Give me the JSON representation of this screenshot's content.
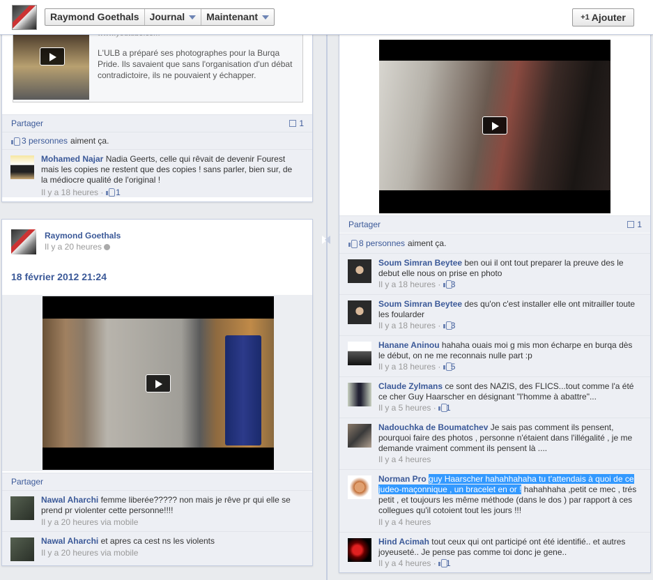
{
  "header": {
    "profile_name": "Raymond Goethals",
    "journal_label": "Journal",
    "now_label": "Maintenant",
    "add_label": "Ajouter",
    "add_prefix": "+1"
  },
  "left_top": {
    "attachment_url": "www.youtube.com",
    "attachment_text": "L'ULB a préparé ses photographes pour la Burqa Pride. Ils savaient que sans l'organisation d'un débat contradictoire, ils ne pouvaient y échapper.",
    "share_label": "Partager",
    "comment_count": "1",
    "likes_count": "3 personnes",
    "likes_suffix": "aiment ça.",
    "comments": [
      {
        "name": "Mohamed Najar",
        "text": "Nadia Geerts, celle qui rêvait de devenir Fourest mais les copies ne restent que des copies ! sans parler, bien sur, de la médiocre qualité de l'original !",
        "time": "Il y a 18 heures",
        "likes": "1"
      }
    ]
  },
  "left_bottom": {
    "poster_name": "Raymond Goethals",
    "time": "Il y a 20 heures",
    "date_title": "18 février 2012 21:24",
    "share_label": "Partager",
    "comments": [
      {
        "name": "Nawal Aharchi",
        "text": "femme liberée????? non mais je rêve pr qui elle se prend pr violenter cette personne!!!!",
        "time": "Il y a 20 heures via mobile"
      },
      {
        "name": "Nawal Aharchi",
        "text": "et apres ca cest ns les violents",
        "time": "Il y a 20 heures via mobile"
      }
    ]
  },
  "right": {
    "share_label": "Partager",
    "comment_count": "1",
    "likes_count": "8 personnes",
    "likes_suffix": "aiment ça.",
    "comments": [
      {
        "name": "Soum Simran Beytee",
        "text": "ben oui il ont tout preparer la preuve des le debut elle nous on prise en photo",
        "time": "Il y a 18 heures",
        "likes": "3"
      },
      {
        "name": "Soum Simran Beytee",
        "text": "des qu'on c'est installer elle ont mitrailler toute les foularder",
        "time": "Il y a 18 heures",
        "likes": "3"
      },
      {
        "name": "Hanane Aninou",
        "text": "hahaha ouais moi g mis mon écharpe en burqa dès le début, on ne me reconnais nulle part :p",
        "time": "Il y a 18 heures",
        "likes": "5"
      },
      {
        "name": "Claude Zylmans",
        "text": "ce sont des NAZIS, des FLICS...tout comme l'a été ce cher Guy Haarscher en désignant \"l'homme à abattre\"...",
        "time": "Il y a 5 heures",
        "likes": "1"
      },
      {
        "name": "Nadouchka de Boumatchev",
        "text": "Je sais pas comment ils pensent, pourquoi faire des photos , personne n'étaient dans l'illégalité , je me demande vraiment comment ils pensent là ....",
        "time": "Il y a 4 heures",
        "likes": ""
      },
      {
        "name": "Norman Pro",
        "text_highlight": "guy Haarscher hahahhahaha tu t'attendais à quoi de ce judeo-maçonnique , un bracelet en or !",
        "text": " hahahhaha ,petit ce mec , trés petit , et toujours les même méthode (dans le dos ) par rapport à ces collegues qu'il cotoient tout les jours !!!",
        "time": "Il y a 4 heures",
        "likes": ""
      },
      {
        "name": "Hind Acimah",
        "text": "tout ceux qui ont participé ont été identifié.. et autres joyeuseté.. Je pense pas comme toi donc je gene..",
        "time": "Il y a 4 heures",
        "likes": "1"
      }
    ]
  }
}
